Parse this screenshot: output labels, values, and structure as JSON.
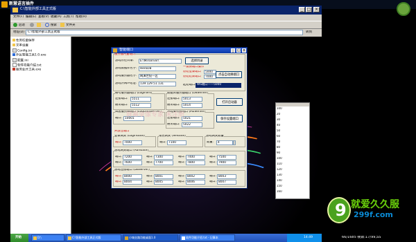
{
  "app": {
    "title": "新慧语言插件"
  },
  "explorer": {
    "title": "C:\\智能外部工具正式版",
    "menu": [
      "文件(F)",
      "编辑(E)",
      "查看(V)",
      "收藏(A)",
      "工具(T)",
      "帮助(H)"
    ],
    "toolbar": {
      "back": "后退",
      "search": "搜索",
      "folders": "文件夹"
    },
    "address": {
      "label": "地址(D)",
      "value": "C:\\智能外部工具正式版",
      "go": "转到"
    },
    "tree": [
      "任务栏量保存",
      "文本设置",
      "Config.ini",
      "外区智能工具1.0.exe",
      "配置.ini",
      "软件功能介绍.txt",
      "服务业开工具.exe"
    ],
    "status": "",
    "right_list": [
      "100",
      "20",
      "30",
      "40",
      "50",
      "60",
      "70",
      "80",
      "90",
      "100",
      "110",
      "120",
      "130",
      "140",
      "150",
      "160"
    ]
  },
  "dialog": {
    "title": "智能端口",
    "section_basic": "服务器内置端口",
    "dir_label": "游戏所在目录:",
    "dir_value": "E:\\Mirserver\\",
    "dir_button": "选择目录",
    "db_label": "游戏数据库名字:",
    "db_value": "HeroDB",
    "server_label": "游戏服务器名字:",
    "server_value": "网演世纪一区",
    "ip_label": "游戏外网IP地址:",
    "ip_value": "139.129.51.131",
    "hint1": "一键换端口操作",
    "hint2_label": "原始登录端口",
    "hint2_value": "5000",
    "hint3_label": "原始结束端口",
    "hint3_value": "7000",
    "auto_button": "点击自动换端口",
    "select_label": "起始端口:",
    "select_value": "WS端口——5000",
    "grp_login": "帐号服务器端口 (LoginSrv)",
    "grp_db": "数据库服务器端口 (DBServer)",
    "grp_log": "日志服务器端口 (LogDataServer)",
    "grp_m2": "游戏服务器端口 (M2Server)",
    "conn_label": "连接端口:",
    "comm_label": "通讯端口:",
    "port_label": "端口:",
    "login_conn": "5511",
    "login_comm": "5512",
    "db_conn": "5013",
    "db_comm": "5014",
    "log_port": "10001",
    "m2_conn": "5021",
    "m2_comm": "5022",
    "start_button": "打开启动器",
    "save_button": "保存设置端口",
    "watermark": "屏幕录像专家 未注册",
    "section_open": "开放性端口",
    "grp_gate_login": "登录网关 (LoginGate)",
    "grp_gate_sel": "角色网关 (SelGate)",
    "grp_gate_num": "游戏网关数量",
    "port_short": "端口:",
    "qty_label": "数量:",
    "gate_login_port": "7000",
    "gate_sel_port": "7100",
    "gate_num": "4",
    "grp_run_gate": "游戏网关端口 (RunGate)",
    "run_ports": [
      "7200",
      "7300",
      "7400",
      "7500",
      "7600",
      "7700",
      "7800",
      "7900"
    ],
    "grp_db_ports": "游戏连接端口 (DBServer)",
    "db_ports": [
      "8000",
      "8001",
      "8002",
      "8003",
      "8004",
      "8005",
      "8006",
      "8007"
    ]
  },
  "taskbar": {
    "start": "开始",
    "tasks": [
      "D:\\",
      "C:\\智能外部工具正式版",
      "小城业路功能桌面1.0",
      "软件功能介绍.txt - 记事本"
    ],
    "time": "14:49"
  },
  "branding": {
    "mark": "9",
    "name": "就爱久久服",
    "url": "299f.com",
    "stat": "66/1685 帧数:17/99,SS"
  }
}
